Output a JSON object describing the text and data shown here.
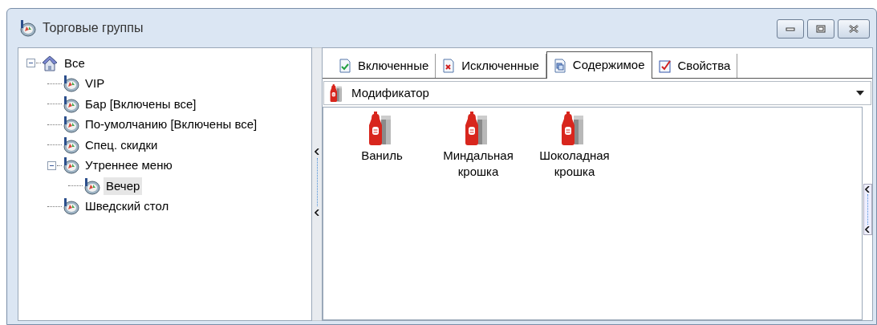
{
  "window": {
    "title": "Торговые группы"
  },
  "tree": [
    {
      "label": "Все",
      "kind": "root",
      "expanded": true,
      "selected": false,
      "children": [
        {
          "label": "VIP",
          "kind": "group",
          "selected": false
        },
        {
          "label": "Бар [Включены все]",
          "kind": "group",
          "selected": false
        },
        {
          "label": "По-умолчанию [Включены все]",
          "kind": "group",
          "selected": false
        },
        {
          "label": "Спец. скидки",
          "kind": "group",
          "selected": false
        },
        {
          "label": "Утреннее меню",
          "kind": "group",
          "expanded": true,
          "selected": false,
          "children": [
            {
              "label": "Вечер",
              "kind": "group",
              "selected": true
            }
          ]
        },
        {
          "label": "Шведский стол",
          "kind": "group",
          "selected": false
        }
      ]
    }
  ],
  "tabs": [
    {
      "label": "Включенные",
      "kind": "included",
      "selected": false
    },
    {
      "label": "Исключенные",
      "kind": "excluded",
      "selected": false
    },
    {
      "label": "Содержимое",
      "kind": "content",
      "selected": true
    },
    {
      "label": "Свойства",
      "kind": "properties",
      "selected": false
    }
  ],
  "type_select": {
    "value": "Модификатор"
  },
  "items": [
    {
      "label": "Ваниль"
    },
    {
      "label": "Миндальная крошка"
    },
    {
      "label": "Шоколадная крошка"
    }
  ]
}
